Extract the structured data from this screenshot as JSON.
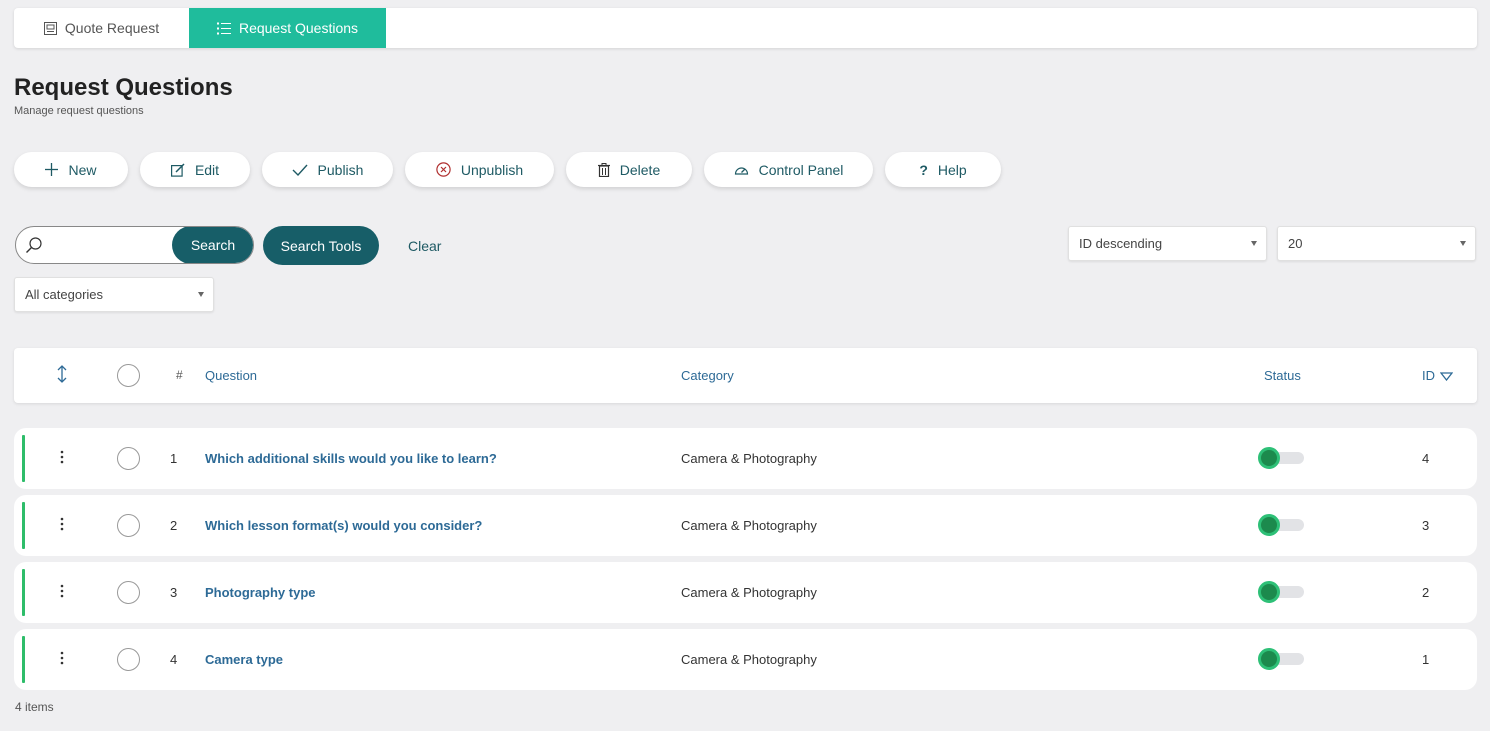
{
  "tabs": [
    {
      "label": "Quote Request",
      "icon": "form-icon",
      "active": false
    },
    {
      "label": "Request Questions",
      "icon": "list-icon",
      "active": true
    }
  ],
  "header": {
    "title": "Request Questions",
    "subtitle": "Manage request questions"
  },
  "toolbar": {
    "new_label": "New",
    "edit_label": "Edit",
    "publish_label": "Publish",
    "unpublish_label": "Unpublish",
    "delete_label": "Delete",
    "control_panel_label": "Control Panel",
    "help_label": "Help"
  },
  "filters": {
    "search_value": "",
    "search_button": "Search",
    "search_tools_button": "Search Tools",
    "clear_label": "Clear",
    "ordering": "ID descending",
    "limit": "20",
    "category": "All categories"
  },
  "table": {
    "headers": {
      "hash": "#",
      "question": "Question",
      "category": "Category",
      "status": "Status",
      "id": "ID"
    },
    "rows": [
      {
        "num": "1",
        "question": "Which additional skills would you like to learn?",
        "category": "Camera & Photography",
        "published": true,
        "id": "4"
      },
      {
        "num": "2",
        "question": "Which lesson format(s) would you consider?",
        "category": "Camera & Photography",
        "published": true,
        "id": "3"
      },
      {
        "num": "3",
        "question": "Photography type",
        "category": "Camera & Photography",
        "published": true,
        "id": "2"
      },
      {
        "num": "4",
        "question": "Camera type",
        "category": "Camera & Photography",
        "published": true,
        "id": "1"
      }
    ]
  },
  "footer": {
    "items_count": "4 items"
  },
  "colors": {
    "accent": "#1fbc9c",
    "primary_dark": "#175e68",
    "link": "#2d6a96",
    "status_on": "#1c8a4d",
    "row_marker": "#2ebd6a",
    "background": "#efeff1"
  }
}
